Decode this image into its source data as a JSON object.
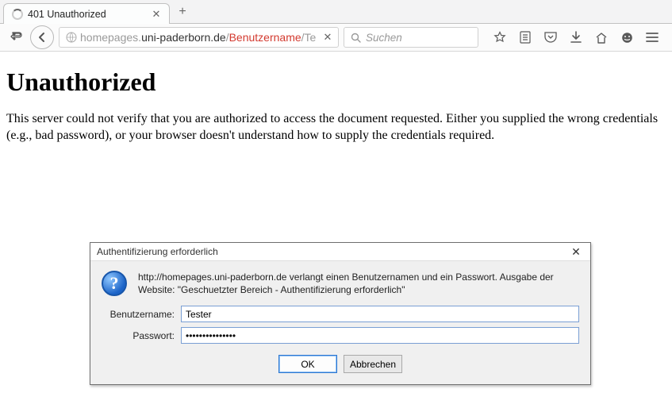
{
  "tab": {
    "title": "401 Unauthorized"
  },
  "url": {
    "p1": "homepages.",
    "p2": "uni-paderborn.de",
    "p3": "/",
    "p4": "Benutzername",
    "p5": "/Test/"
  },
  "search": {
    "placeholder": "Suchen"
  },
  "page": {
    "heading": "Unauthorized",
    "body": "This server could not verify that you are authorized to access the document requested. Either you supplied the wrong credentials (e.g., bad password), or your browser doesn't understand how to supply the credentials required."
  },
  "dialog": {
    "title": "Authentifizierung erforderlich",
    "message": "http://homepages.uni-paderborn.de verlangt einen Benutzernamen und ein Passwort. Ausgabe der Website: \"Geschuetzter Bereich - Authentifizierung erforderlich\"",
    "username_label": "Benutzername:",
    "password_label": "Passwort:",
    "username_value": "Tester",
    "password_value": "•••••••••••••••",
    "ok_label": "OK",
    "cancel_label": "Abbrechen"
  }
}
